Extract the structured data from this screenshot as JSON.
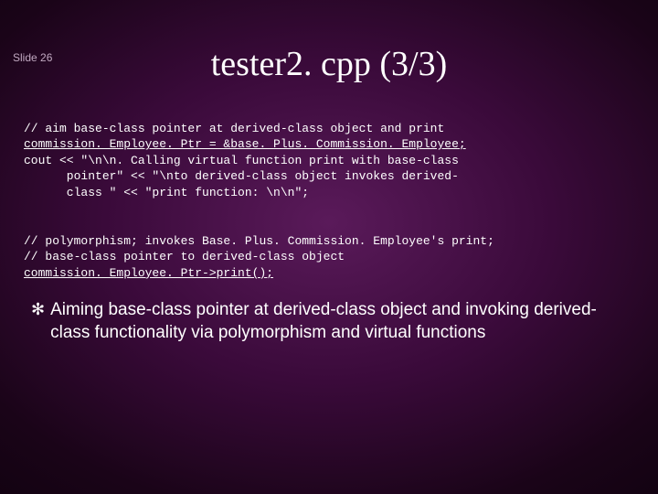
{
  "slide_label": "Slide 26",
  "title": "tester2. cpp (3/3)",
  "code1": {
    "line1": "// aim base-class pointer at derived-class object and print",
    "line2": "commission. Employee. Ptr = &base. Plus. Commission. Employee;",
    "line3a": "cout << \"\\n\\n. Calling virtual function print with base-class",
    "line3b": "      pointer\" << \"\\nto derived-class object invokes derived-",
    "line3c": "      class \" << \"print function: \\n\\n\";"
  },
  "code2": {
    "line1": "// polymorphism; invokes Base. Plus. Commission. Employee's print;",
    "line2": "// base-class pointer to derived-class object",
    "line3": "commission. Employee. Ptr->print();"
  },
  "bullet_icon": "✻",
  "bullet_text": "Aiming base-class pointer at derived-class object and invoking derived-class functionality via polymorphism and virtual functions"
}
